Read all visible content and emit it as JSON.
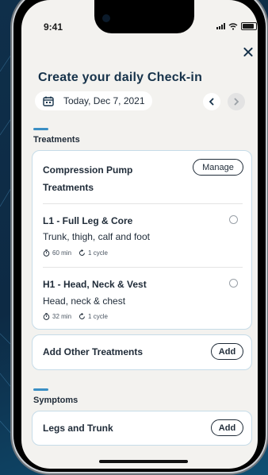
{
  "status_bar": {
    "time": "9:41"
  },
  "header": {
    "title": "Create your daily Check-in",
    "date_label": "Today, Dec 7, 2021"
  },
  "icons": {
    "close": "close-icon",
    "calendar": "calendar-icon",
    "prev": "chevron-left-icon",
    "next": "chevron-right-icon",
    "timer": "timer-icon",
    "cycle": "cycle-icon"
  },
  "treatments": {
    "section_label": "Treatments",
    "pump_title": "Compression Pump Treatments",
    "manage_label": "Manage",
    "items": [
      {
        "title": "L1 - Full Leg & Core",
        "subtitle": "Trunk, thigh, calf and foot",
        "duration": "60 min",
        "cycles": "1 cycle"
      },
      {
        "title": "H1 - Head, Neck & Vest",
        "subtitle": "Head, neck & chest",
        "duration": "32 min",
        "cycles": "1 cycle"
      }
    ],
    "other_label": "Add Other Treatments",
    "other_add": "Add"
  },
  "symptoms": {
    "section_label": "Symptoms",
    "legs_label": "Legs and Trunk",
    "legs_add": "Add"
  },
  "colors": {
    "accent": "#3a8fc4",
    "title": "#16324a",
    "card_border": "#c6dce8",
    "screen_bg": "#f3f2ef"
  }
}
